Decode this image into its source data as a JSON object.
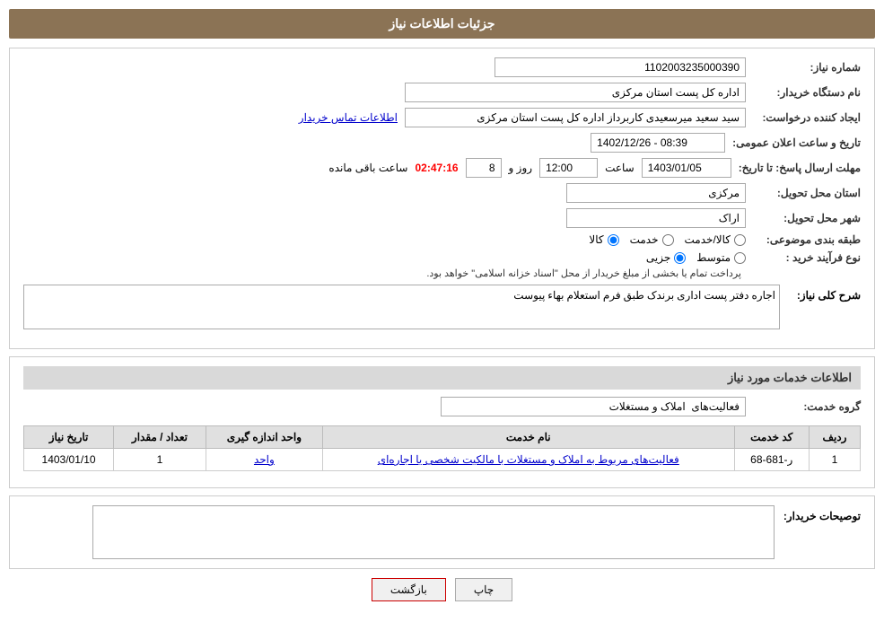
{
  "page": {
    "title": "جزئیات اطلاعات نیاز"
  },
  "info": {
    "need_number_label": "شماره نیاز:",
    "need_number_value": "1102003235000390",
    "buyer_org_label": "نام دستگاه خریدار:",
    "buyer_org_value": "اداره کل پست استان مرکزی",
    "creator_label": "ایجاد کننده درخواست:",
    "creator_name": "سید سعید میرسعیدی کاربرداز اداره کل پست استان مرکزی",
    "creator_link": "اطلاعات تماس خریدار",
    "public_announce_label": "تاریخ و ساعت اعلان عمومی:",
    "public_announce_value": "1402/12/26 - 08:39",
    "response_deadline_label": "مهلت ارسال پاسخ: تا تاریخ:",
    "response_date": "1403/01/05",
    "response_time_label": "ساعت",
    "response_time": "12:00",
    "response_days_label": "روز و",
    "response_days": "8",
    "response_countdown_label": "ساعت باقی مانده",
    "response_countdown": "02:47:16",
    "province_label": "استان محل تحویل:",
    "province_value": "مرکزی",
    "city_label": "شهر محل تحویل:",
    "city_value": "اراک",
    "category_label": "طبقه بندی موضوعی:",
    "category_goods": "کالا",
    "category_service": "خدمت",
    "category_goods_service": "کالا/خدمت",
    "purchase_type_label": "نوع فرآیند خرید :",
    "purchase_partial": "جزیی",
    "purchase_medium": "متوسط",
    "purchase_note": "پرداخت تمام یا بخشی از مبلغ خریدار از محل \"اسناد خزانه اسلامی\" خواهد بود.",
    "need_desc_label": "شرح کلی نیاز:",
    "need_desc_value": "اجاره دفتر پست اداری برندک طبق فرم استعلام بهاء پیوست",
    "services_section_title": "اطلاعات خدمات مورد نیاز",
    "service_group_label": "گروه خدمت:",
    "service_group_value": "فعالیت‌های  املاک و مستغلات",
    "table": {
      "headers": [
        "ردیف",
        "کد خدمت",
        "نام خدمت",
        "واحد اندازه گیری",
        "تعداد / مقدار",
        "تاریخ نیاز"
      ],
      "rows": [
        {
          "row": "1",
          "code": "ر-681-68",
          "service_name": "فعالیت‌های مربوط به املاک و مستغلات با مالکیت شخصی یا اجاره‌ای",
          "unit": "واحد",
          "quantity": "1",
          "date": "1403/01/10"
        }
      ]
    },
    "buyer_desc_label": "توصیحات خریدار:"
  },
  "buttons": {
    "print": "چاپ",
    "back": "بازگشت"
  }
}
